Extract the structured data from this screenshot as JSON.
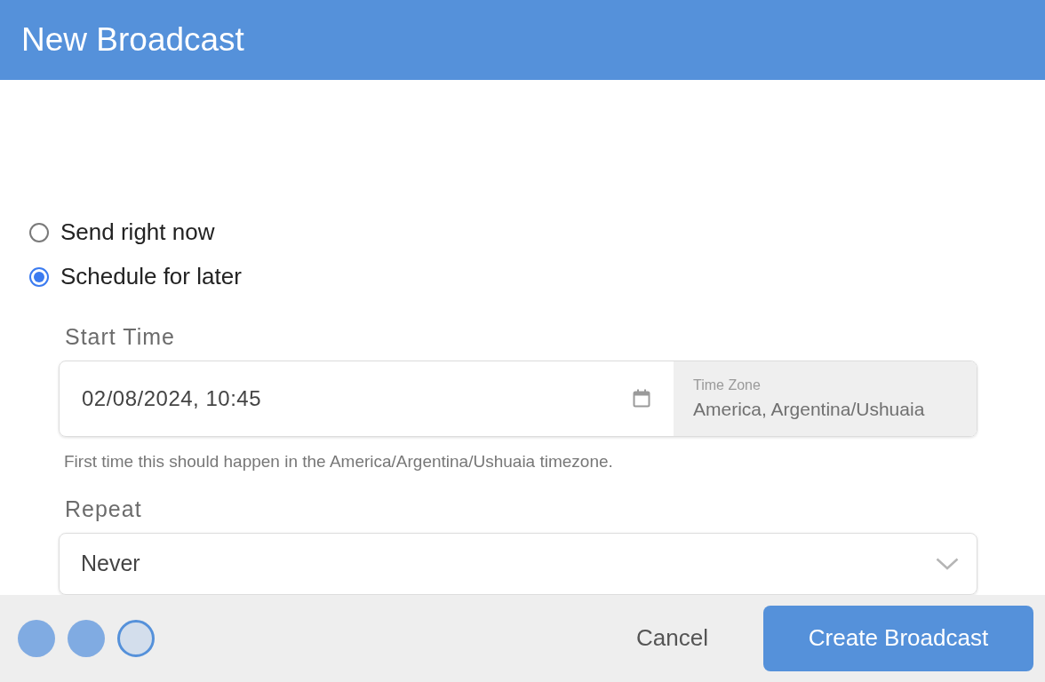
{
  "dialog": {
    "title": "New Broadcast"
  },
  "send_options": [
    {
      "label": "Send right now",
      "selected": false
    },
    {
      "label": "Schedule for later",
      "selected": true
    }
  ],
  "start_time": {
    "label": "Start Time",
    "value": "02/08/2024, 10:45",
    "time_zone_label": "Time Zone",
    "time_zone": "America, Argentina/Ushuaia",
    "hint": "First time this should happen in the America/Argentina/Ushuaia timezone."
  },
  "repeat": {
    "label": "Repeat",
    "value": "Never"
  },
  "steps": [
    {
      "selected": false
    },
    {
      "selected": false
    },
    {
      "selected": true
    }
  ],
  "buttons": {
    "cancel": "Cancel",
    "create": "Create Broadcast"
  }
}
